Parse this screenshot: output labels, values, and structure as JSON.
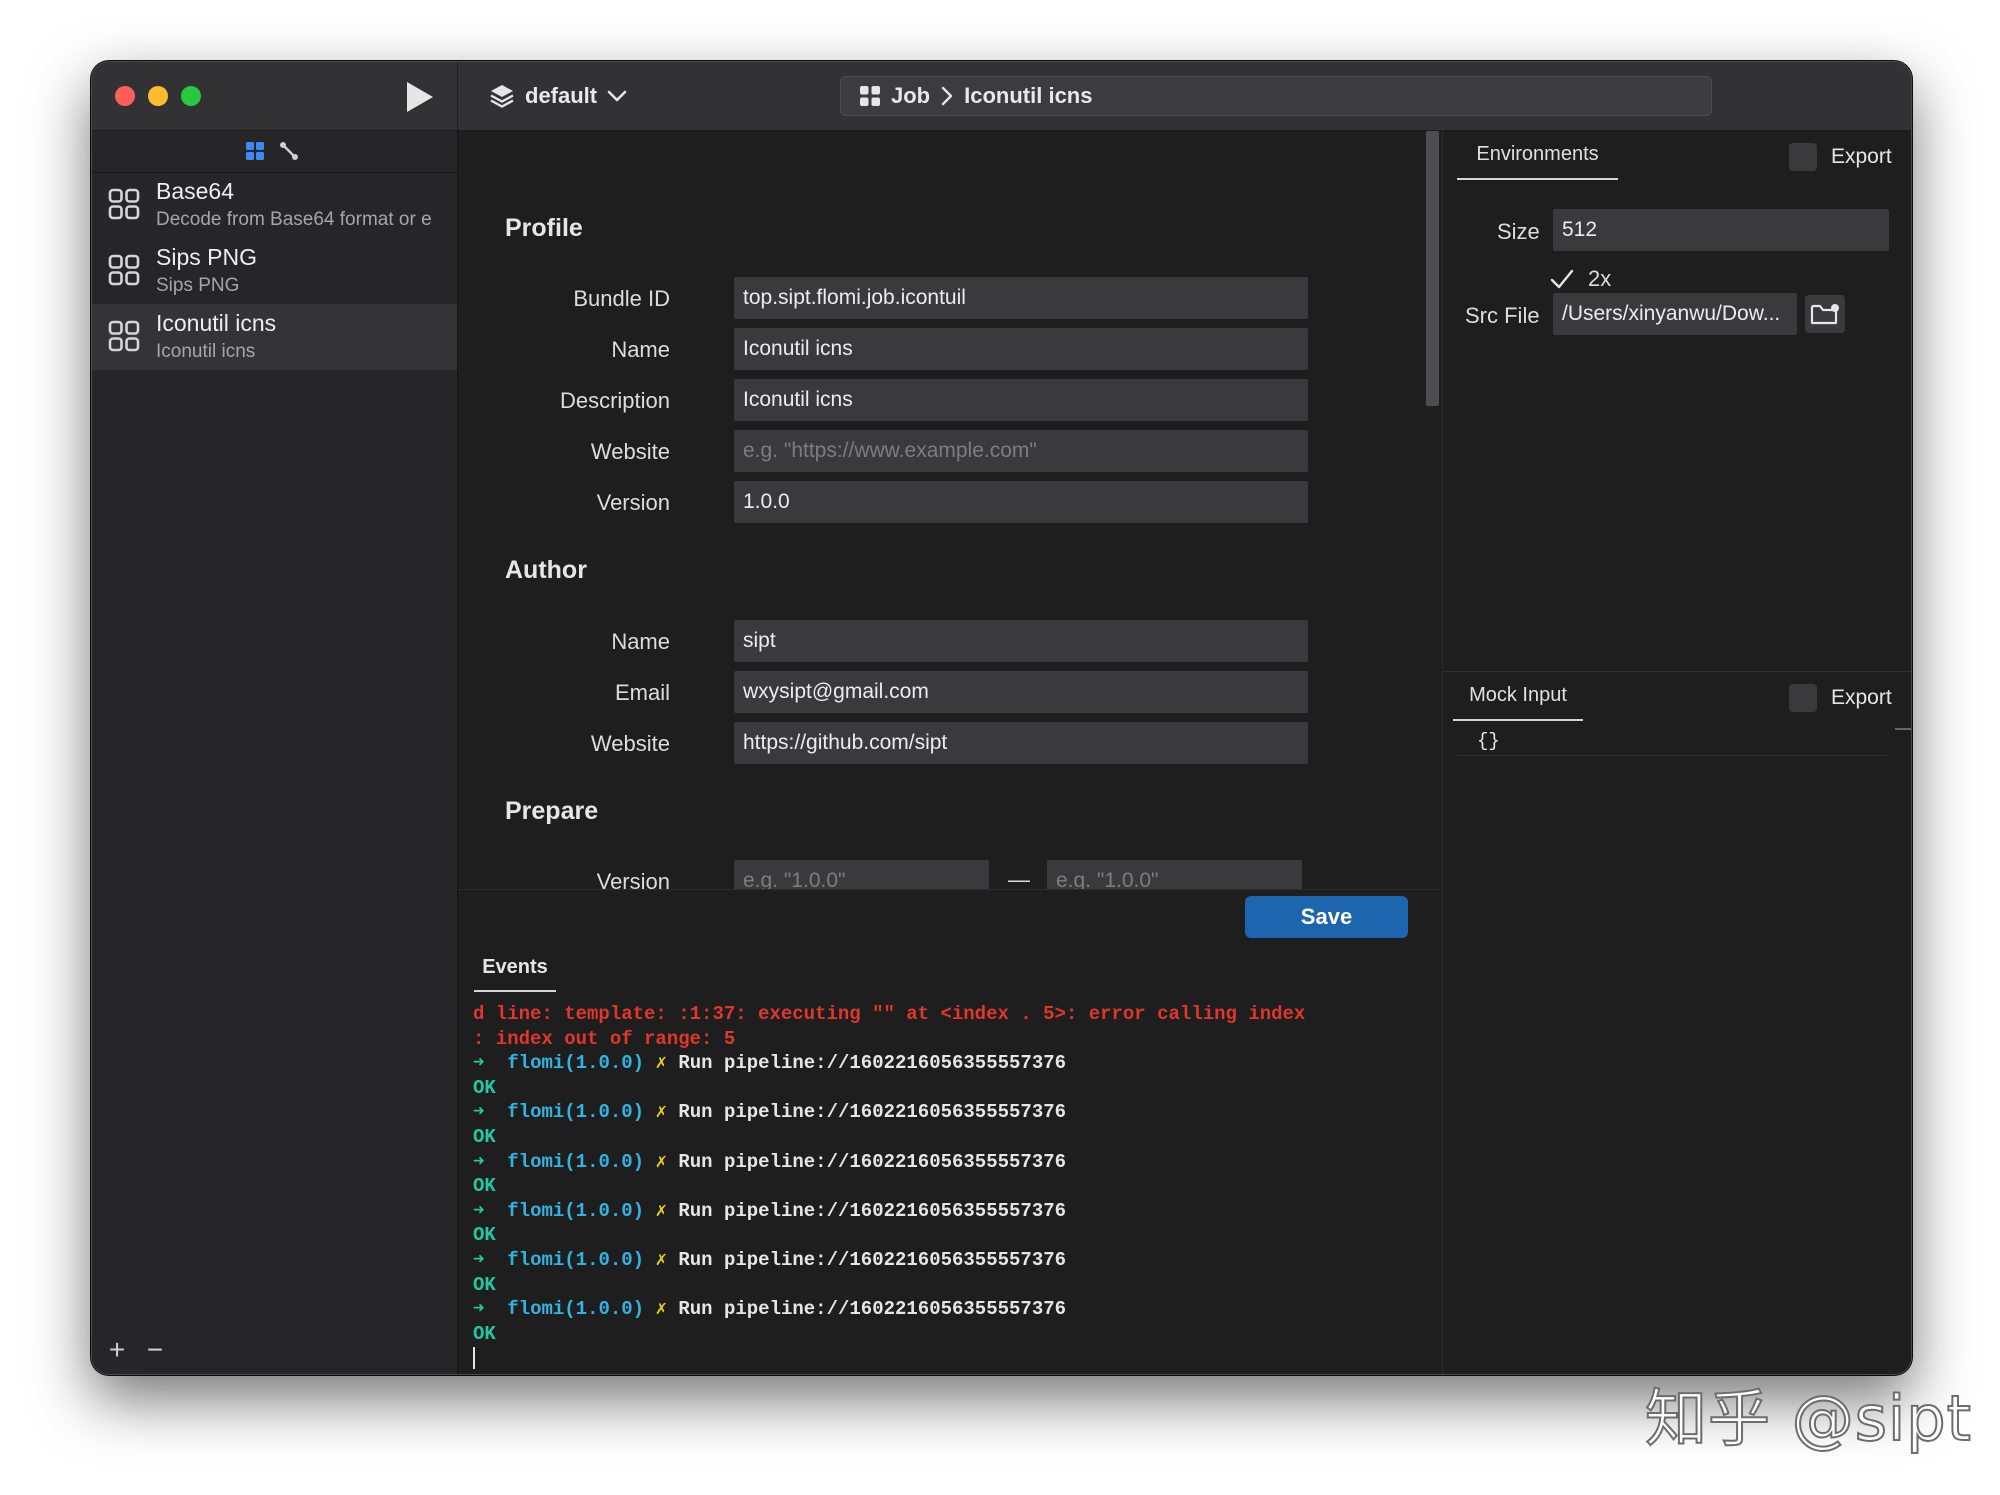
{
  "window": {
    "profile_select": "default",
    "breadcrumb": {
      "root": "Job",
      "current": "Iconutil icns"
    }
  },
  "sidebar": {
    "jobs": [
      {
        "title": "Base64",
        "subtitle": "Decode from Base64 format or e"
      },
      {
        "title": "Sips PNG",
        "subtitle": "Sips PNG"
      },
      {
        "title": "Iconutil icns",
        "subtitle": "Iconutil icns",
        "selected": true
      }
    ],
    "add_label": "+",
    "remove_label": "−"
  },
  "form": {
    "profile": {
      "title": "Profile",
      "bundle_id_label": "Bundle ID",
      "bundle_id_value": "top.sipt.flomi.job.icontuil",
      "name_label": "Name",
      "name_value": "Iconutil icns",
      "description_label": "Description",
      "description_value": "Iconutil icns",
      "website_label": "Website",
      "website_value": "",
      "website_placeholder": "e.g. \"https://www.example.com\"",
      "version_label": "Version",
      "version_value": "1.0.0"
    },
    "author": {
      "title": "Author",
      "name_label": "Name",
      "name_value": "sipt",
      "email_label": "Email",
      "email_value": "wxysipt@gmail.com",
      "website_label": "Website",
      "website_value": "https://github.com/sipt"
    },
    "prepare": {
      "title": "Prepare",
      "version_label": "Version",
      "version_from_placeholder": "e.g. \"1.0.0\"",
      "version_to_placeholder": "e.g. \"1.0.0\"",
      "range_separator": "—"
    },
    "save_label": "Save"
  },
  "events": {
    "tab_label": "Events",
    "error_lines": [
      "d line: template: :1:37: executing \"\" at <index . 5>: error calling index",
      ": index out of range: 5"
    ],
    "runs": [
      {
        "arrow": "➜",
        "pkg": "flomi(1.0.0)",
        "mark": "✗",
        "text": "Run pipeline://1602216056355557376",
        "status": "OK"
      },
      {
        "arrow": "➜",
        "pkg": "flomi(1.0.0)",
        "mark": "✗",
        "text": "Run pipeline://1602216056355557376",
        "status": "OK"
      },
      {
        "arrow": "➜",
        "pkg": "flomi(1.0.0)",
        "mark": "✗",
        "text": "Run pipeline://1602216056355557376",
        "status": "OK"
      },
      {
        "arrow": "➜",
        "pkg": "flomi(1.0.0)",
        "mark": "✗",
        "text": "Run pipeline://1602216056355557376",
        "status": "OK"
      },
      {
        "arrow": "➜",
        "pkg": "flomi(1.0.0)",
        "mark": "✗",
        "text": "Run pipeline://1602216056355557376",
        "status": "OK"
      },
      {
        "arrow": "➜",
        "pkg": "flomi(1.0.0)",
        "mark": "✗",
        "text": "Run pipeline://1602216056355557376",
        "status": "OK"
      }
    ]
  },
  "environments": {
    "tab_label": "Environments",
    "export_label": "Export",
    "size_label": "Size",
    "size_value": "512",
    "retina_label": "2x",
    "retina_checked": true,
    "src_file_label": "Src File",
    "src_file_value": "/Users/xinyanwu/Dow..."
  },
  "mock_input": {
    "tab_label": "Mock Input",
    "export_label": "Export",
    "value": "{}"
  },
  "watermark": "知乎 @sipt",
  "colors": {
    "accent": "#1e65b0",
    "window_bg": "#1e1e1e",
    "titlebar_bg": "#323234",
    "console_error": "#e0362c",
    "console_ok": "#26c6a0",
    "console_pkg": "#2fb4e3",
    "console_mark": "#e6cf1b"
  },
  "icons": {
    "play": "play-icon",
    "stack": "layers-icon",
    "chevron": "chevron-down-icon",
    "grid": "grid-icon",
    "pipeline": "pipeline-icon",
    "folder": "folder-open-icon",
    "check": "check-icon"
  }
}
